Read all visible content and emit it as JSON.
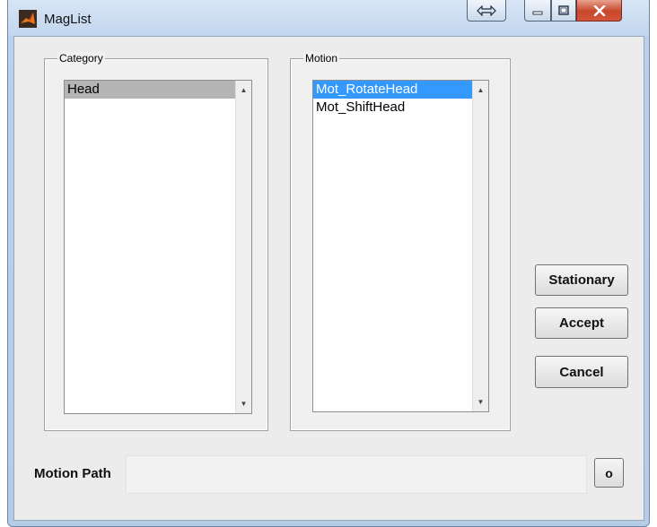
{
  "window": {
    "title": "MagList",
    "dock_icon": "dock-arrows-icon",
    "minimize_icon": "minimize-icon",
    "maximize_icon": "maximize-icon",
    "close_icon": "close-icon"
  },
  "category": {
    "label": "Category",
    "items": [
      "Head"
    ],
    "selected": "Head"
  },
  "motion": {
    "label": "Motion",
    "items": [
      "Mot_RotateHead",
      "Mot_ShiftHead"
    ],
    "selected": "Mot_RotateHead"
  },
  "buttons": {
    "stationary": "Stationary",
    "accept": "Accept",
    "cancel": "Cancel",
    "browse": "o"
  },
  "motion_path": {
    "label": "Motion Path",
    "value": ""
  },
  "colors": {
    "selection_blue": "#3399ff",
    "selection_gray": "#b4b4b4",
    "close_red": "#c7472c"
  }
}
